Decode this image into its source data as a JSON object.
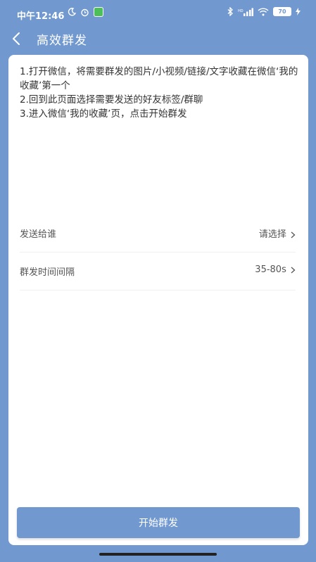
{
  "status_bar": {
    "time": "中午12:46",
    "battery": "70"
  },
  "header": {
    "title": "高效群发"
  },
  "instructions": [
    "1.打开微信，将需要群发的图片/小视频/链接/文字收藏在微信‘我的收藏’第一个",
    "2.回到此页面选择需要发送的好友标签/群聊",
    "3.进入微信‘我的收藏’页，点击开始群发"
  ],
  "settings": {
    "recipient_label": "发送给谁",
    "recipient_value": "请选择",
    "interval_label": "群发时间间隔",
    "interval_value": "35-80s"
  },
  "actions": {
    "start_label": "开始群发"
  },
  "colors": {
    "primary": "#7199cf",
    "card": "#ffffff",
    "text": "#333333"
  }
}
